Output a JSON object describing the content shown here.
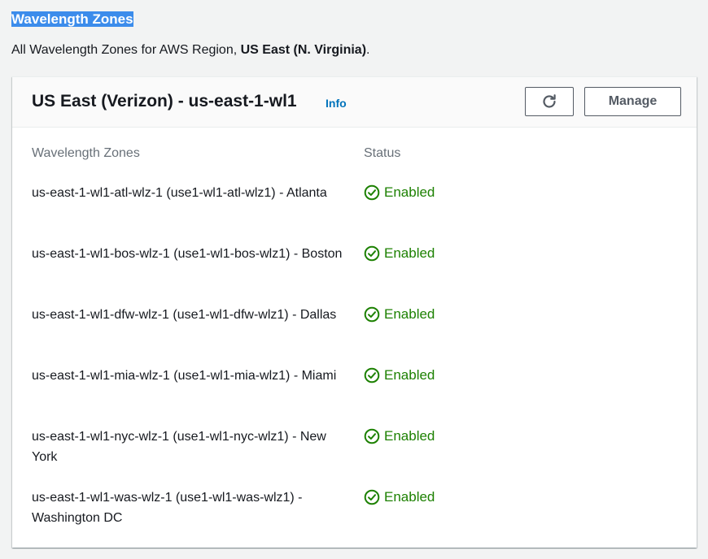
{
  "page": {
    "title": "Wavelength Zones",
    "description_prefix": "All Wavelength Zones for AWS Region, ",
    "region": "US East (N. Virginia)",
    "description_suffix": "."
  },
  "panel": {
    "title": "US East (Verizon) - us-east-1-wl1",
    "info_label": "Info",
    "refresh_icon": "refresh-icon",
    "manage_label": "Manage"
  },
  "table": {
    "columns": [
      "Wavelength Zones",
      "Status"
    ],
    "rows": [
      {
        "zone": "us-east-1-wl1-atl-wlz-1 (use1-wl1-atl-wlz1) - Atlanta",
        "status": "Enabled"
      },
      {
        "zone": "us-east-1-wl1-bos-wlz-1 (use1-wl1-bos-wlz1) - Boston",
        "status": "Enabled"
      },
      {
        "zone": "us-east-1-wl1-dfw-wlz-1 (use1-wl1-dfw-wlz1) - Dallas",
        "status": "Enabled"
      },
      {
        "zone": "us-east-1-wl1-mia-wlz-1 (use1-wl1-mia-wlz1) - Miami",
        "status": "Enabled"
      },
      {
        "zone": "us-east-1-wl1-nyc-wlz-1 (use1-wl1-nyc-wlz1) - New York",
        "status": "Enabled"
      },
      {
        "zone": "us-east-1-wl1-was-wlz-1 (use1-wl1-was-wlz1) - Washington DC",
        "status": "Enabled"
      }
    ]
  },
  "colors": {
    "accent_link": "#0073bb",
    "status_success": "#1d8102",
    "selection_highlight": "#3c8ceb"
  }
}
